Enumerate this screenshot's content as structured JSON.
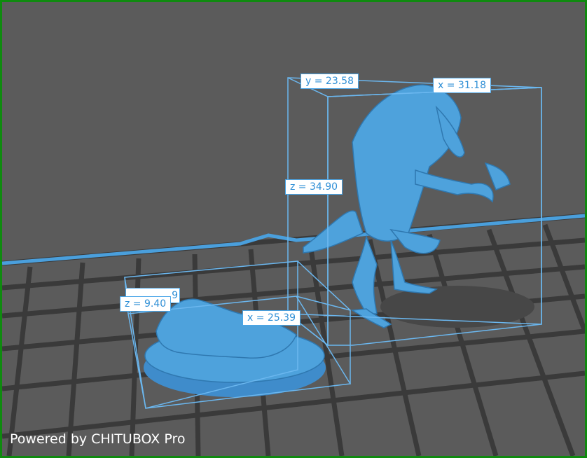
{
  "viewport": {
    "watermark": "Powered by CHITUBOX Pro",
    "model_color": "#4ea2dc",
    "bbox_color": "#6bb7ef",
    "background_color": "#5b5b5b",
    "grid_color": "#3c3c3c"
  },
  "model_large": {
    "name": "creature-figure",
    "dimensions": {
      "x": "x = 31.18",
      "y": "y = 23.58",
      "z": "z = 34.90"
    }
  },
  "model_small": {
    "name": "creature-on-base",
    "dimensions": {
      "x": "x = 25.39",
      "y_partial": "9",
      "z": "z = 9.40"
    }
  }
}
